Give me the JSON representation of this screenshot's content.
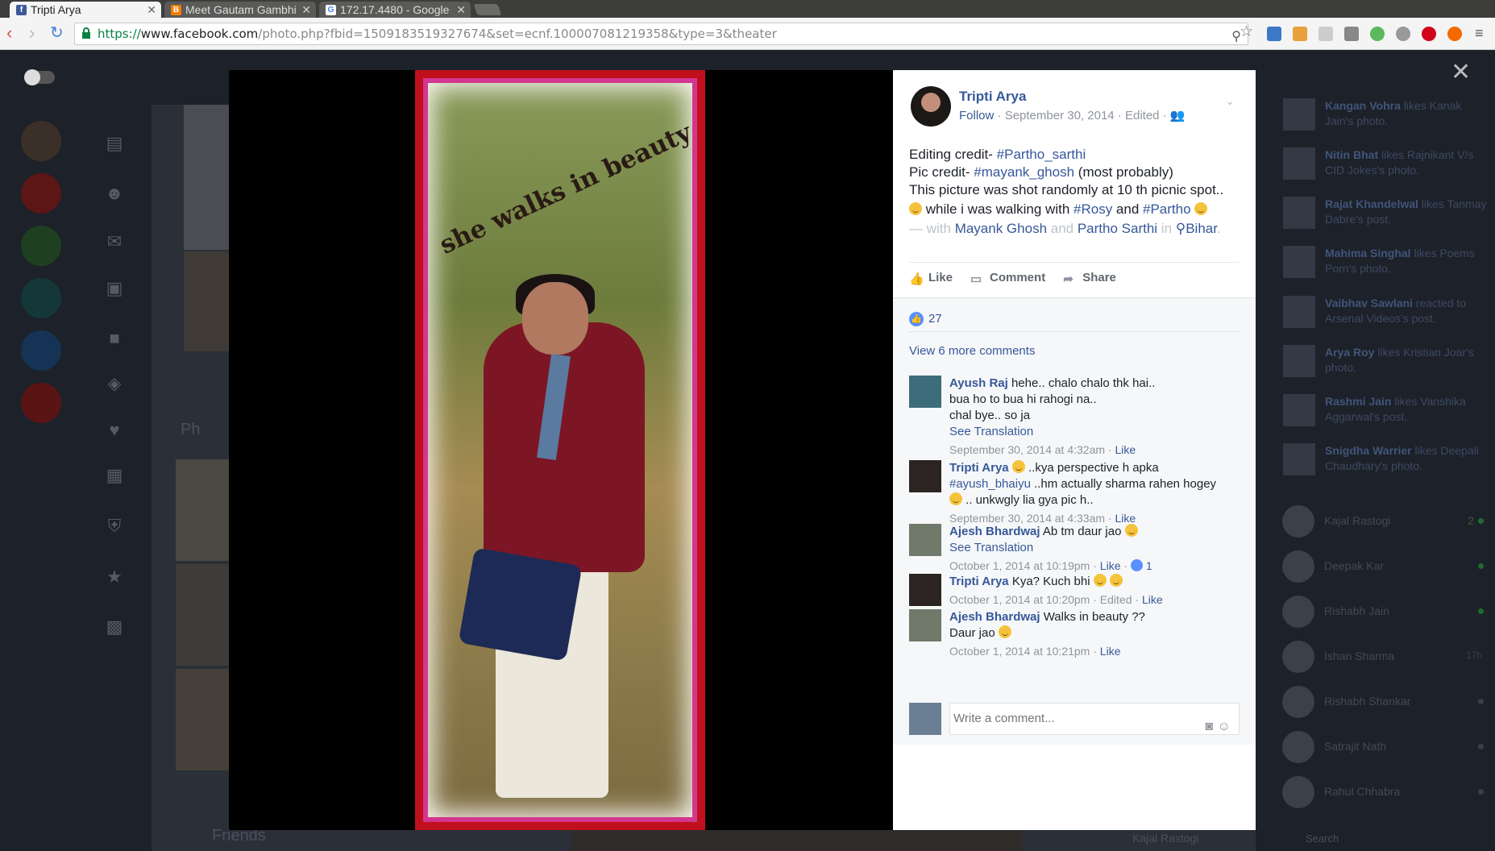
{
  "browser": {
    "tabs": [
      {
        "title": "Tripti Arya",
        "icon": "facebook-icon",
        "active": true
      },
      {
        "title": "Meet Gautam Gambhi",
        "icon": "blogger-icon",
        "active": false
      },
      {
        "title": "172.17.4480 - Google",
        "icon": "google-icon",
        "active": false
      }
    ],
    "url_proto": "https://",
    "url_host": "www.facebook.com",
    "url_path": "/photo.php?fbid=1509183519327674&set=ecnf.100007081219358&type=3&theater"
  },
  "post": {
    "author": "Tripti Arya",
    "follow": "Follow",
    "date": "September 30, 2014",
    "edited": "Edited",
    "line1_prefix": "Editing credit- ",
    "line1_tag": "#Partho_sarthi",
    "line2_prefix": "Pic credit- ",
    "line2_tag": "#mayank_ghosh",
    "line2_suffix": " (most probably)",
    "line3": "This picture was shot randomly at 10 th picnic spot..",
    "line4_a": " while i was walking with ",
    "line4_tag1": "#Rosy",
    "line4_and": " and ",
    "line4_tag2": "#Partho",
    "with_prefix": "— with ",
    "with_person1": "Mayank Ghosh",
    "with_and": " and ",
    "with_person2": "Partho Sarthi",
    "with_in": " in ",
    "location": "Bihar",
    "photo_caption": "she walks in beauty"
  },
  "actions": {
    "like": "Like",
    "comment": "Comment",
    "share": "Share"
  },
  "feedback": {
    "like_count": "27",
    "view_more": "View 6 more comments",
    "write_placeholder": "Write a comment..."
  },
  "comments": [
    {
      "name": "Ayush Raj",
      "text": "hehe.. chalo chalo thk hai..",
      "text2": "bua ho to bua hi rahogi na..",
      "text3": "chal bye.. so ja",
      "translation": "See Translation",
      "time": "September 30, 2014 at 4:32am",
      "like": "Like"
    },
    {
      "name": "Tripti Arya",
      "text": " ..kya perspective h apka",
      "tag": "#ayush_bhaiyu",
      "text2": " ..hm actually sharma rahen hogey",
      "text3": " .. unkwgly lia gya pic h..",
      "time": "September 30, 2014 at 4:33am",
      "like": "Like"
    },
    {
      "name": "Ajesh Bhardwaj",
      "text": "Ab tm daur jao",
      "translation": "See Translation",
      "time": "October 1, 2014 at 10:19pm",
      "like": "Like",
      "reactions": "1"
    },
    {
      "name": "Tripti Arya",
      "text": "Kya? Kuch bhi",
      "time": "October 1, 2014 at 10:20pm",
      "edited": "Edited",
      "like": "Like"
    },
    {
      "name": "Ajesh Bhardwaj",
      "text": "Walks in beauty ??",
      "text2": "Daur jao",
      "time": "October 1, 2014 at 10:21pm",
      "like": "Like"
    }
  ],
  "ticker": [
    {
      "name": "Kangan Vohra",
      "rest": " likes Kanak Jain's photo."
    },
    {
      "name": "Nitin Bhat",
      "rest": " likes Rajnikant V/s CID Jokes's photo."
    },
    {
      "name": "Rajat Khandelwal",
      "rest": " likes Tanmay Dabre's post."
    },
    {
      "name": "Mahima Singhal",
      "rest": " likes Poems Porn's photo."
    },
    {
      "name": "Vaibhav Sawlani",
      "rest": " reacted to Arsenal Videos's post."
    },
    {
      "name": "Arya Roy",
      "rest": " likes Kristian Joar's photo."
    },
    {
      "name": "Rashmi Jain",
      "rest": " likes Vanshika Aggarwal's post."
    },
    {
      "name": "Snigdha Warrier",
      "rest": " likes Deepali Chaudhary's photo."
    }
  ],
  "chat": [
    {
      "name": "Kajal Rastogi",
      "badge": "2"
    },
    {
      "name": "Deepak Kar"
    },
    {
      "name": "Rishabh Jain"
    },
    {
      "name": "Ishan Sharma",
      "badge": "17h"
    },
    {
      "name": "Rishabh Shankar"
    },
    {
      "name": "Satrajit Nath"
    },
    {
      "name": "Rahul Chhabra"
    }
  ],
  "background": {
    "friends_label": "Friends",
    "photos_label": "Ph",
    "chat_bottom": "Kajal Rastogi",
    "search": "Search"
  }
}
